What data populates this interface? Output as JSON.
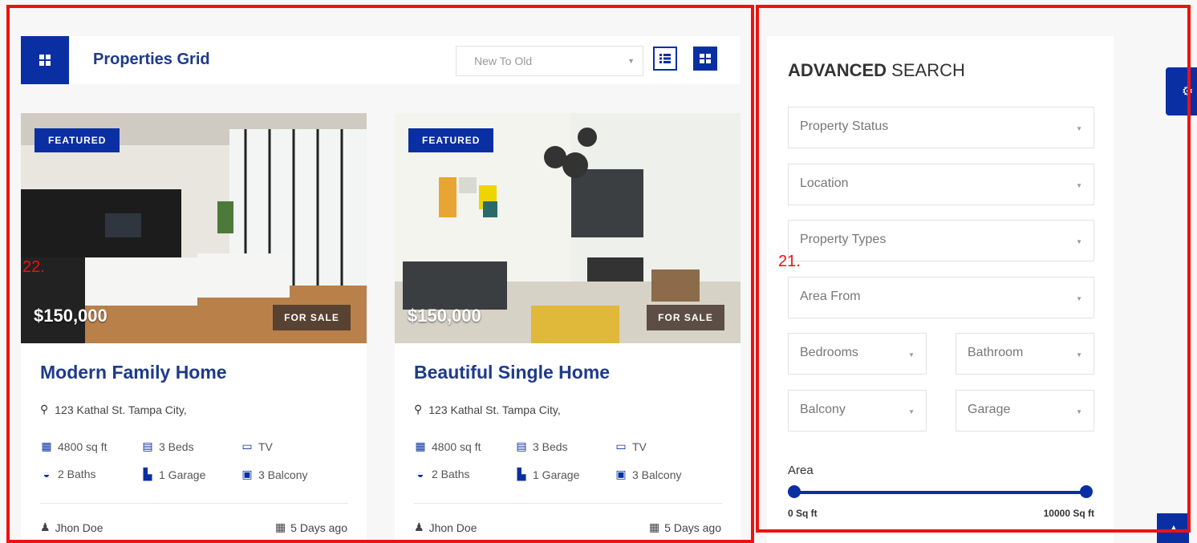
{
  "header": {
    "title": "Properties Grid",
    "sort_value": "New To Old"
  },
  "cards": [
    {
      "badge": "FEATURED",
      "price": "$150,000",
      "status": "FOR SALE",
      "title": "Modern Family Home",
      "address": "123 Kathal St. Tampa City,",
      "area": "4800 sq ft",
      "beds": "3 Beds",
      "tv": "TV",
      "baths": "2 Baths",
      "garage": "1 Garage",
      "balcony": "3 Balcony",
      "author": "Jhon Doe",
      "date": "5 Days ago"
    },
    {
      "badge": "FEATURED",
      "price": "$150,000",
      "status": "FOR SALE",
      "title": "Beautiful Single Home",
      "address": "123 Kathal St. Tampa City,",
      "area": "4800 sq ft",
      "beds": "3 Beds",
      "tv": "TV",
      "baths": "2 Baths",
      "garage": "1 Garage",
      "balcony": "3 Balcony",
      "author": "Jhon Doe",
      "date": "5 Days ago"
    }
  ],
  "search": {
    "title_bold": "ADVANCED",
    "title_rest": "SEARCH",
    "property_status": "Property Status",
    "location": "Location",
    "property_types": "Property Types",
    "area_from": "Area From",
    "bedrooms": "Bedrooms",
    "bathroom": "Bathroom",
    "balcony": "Balcony",
    "garage": "Garage",
    "area_label": "Area",
    "slider_min": "0 Sq ft",
    "slider_max": "10000 Sq ft"
  },
  "annotations": {
    "left": "22.",
    "right": "21."
  },
  "colors": {
    "accent": "#0a2fa3",
    "title": "#1e3a8a",
    "annotation": "#ee1111"
  }
}
